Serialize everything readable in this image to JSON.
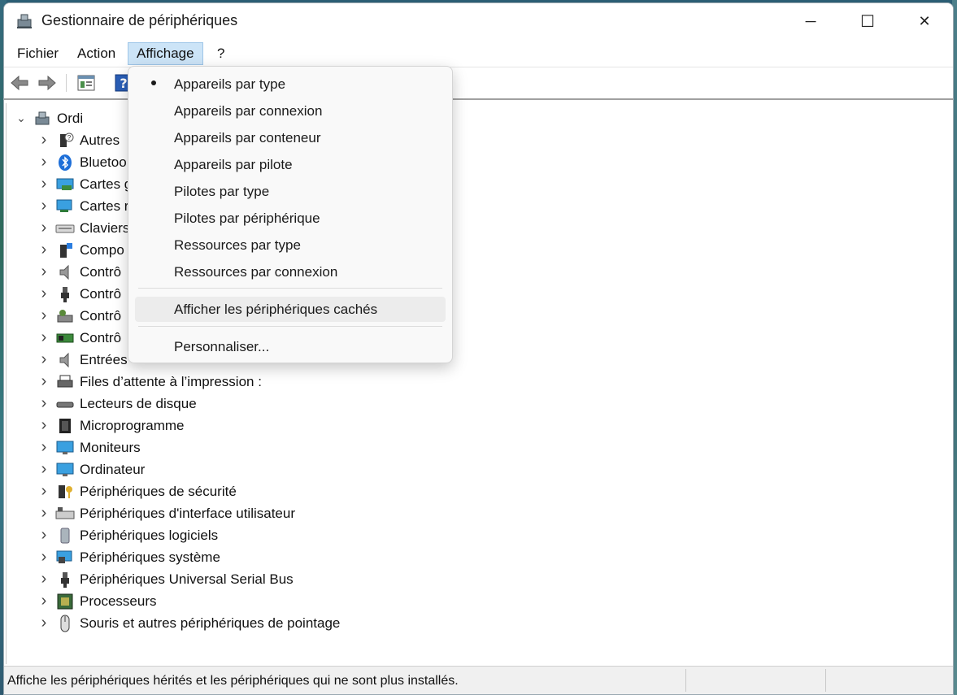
{
  "window": {
    "title": "Gestionnaire de périphériques",
    "controls": {
      "minimize": "─",
      "maximize": "☐",
      "close": "✕"
    }
  },
  "menubar": {
    "items": [
      {
        "label": "Fichier"
      },
      {
        "label": "Action"
      },
      {
        "label": "Affichage",
        "active": true
      },
      {
        "label": "?"
      }
    ]
  },
  "toolbar": {
    "buttons": [
      "back-arrow-icon",
      "forward-arrow-icon",
      "properties-icon",
      "help-icon"
    ]
  },
  "tree": {
    "root": {
      "label": "Ordi",
      "expanded": true
    },
    "categories": [
      {
        "label": "Autres",
        "icon": "unknown-device-icon"
      },
      {
        "label": "Bluetoo",
        "icon": "bluetooth-icon"
      },
      {
        "label": "Cartes g",
        "icon": "display-adapter-icon"
      },
      {
        "label": "Cartes r",
        "icon": "network-adapter-icon"
      },
      {
        "label": "Claviers",
        "icon": "keyboard-icon"
      },
      {
        "label": "Compo",
        "icon": "software-component-icon"
      },
      {
        "label": "Contrô",
        "icon": "audio-controller-icon"
      },
      {
        "label": "Contrô",
        "icon": "usb-controller-icon"
      },
      {
        "label": "Contrô",
        "icon": "storage-controller-icon"
      },
      {
        "label": "Contrô",
        "icon": "ide-controller-icon"
      },
      {
        "label": "Entrées",
        "icon": "audio-input-icon"
      },
      {
        "label": "Files d’attente à l’impression :",
        "icon": "printer-icon"
      },
      {
        "label": "Lecteurs de disque",
        "icon": "disk-drive-icon"
      },
      {
        "label": "Microprogramme",
        "icon": "firmware-icon"
      },
      {
        "label": "Moniteurs",
        "icon": "monitor-icon"
      },
      {
        "label": "Ordinateur",
        "icon": "computer-icon"
      },
      {
        "label": "Périphériques de sécurité",
        "icon": "security-device-icon"
      },
      {
        "label": "Périphériques d'interface utilisateur",
        "icon": "hid-icon"
      },
      {
        "label": "Périphériques logiciels",
        "icon": "software-device-icon"
      },
      {
        "label": "Périphériques système",
        "icon": "system-device-icon"
      },
      {
        "label": "Périphériques Universal Serial Bus",
        "icon": "usb-device-icon"
      },
      {
        "label": "Processeurs",
        "icon": "processor-icon"
      },
      {
        "label": "Souris et autres périphériques de pointage",
        "icon": "mouse-icon"
      }
    ]
  },
  "dropdown": {
    "items": [
      {
        "label": "Appareils par type",
        "checked": true
      },
      {
        "label": "Appareils par connexion"
      },
      {
        "label": "Appareils par conteneur"
      },
      {
        "label": "Appareils par pilote"
      },
      {
        "label": "Pilotes par type"
      },
      {
        "label": "Pilotes par périphérique"
      },
      {
        "label": "Ressources par type"
      },
      {
        "label": "Ressources par connexion"
      },
      {
        "label": "Afficher les périphériques cachés",
        "hover": true
      },
      {
        "label": "Personnaliser..."
      }
    ]
  },
  "status": {
    "text": "Affiche les périphériques hérités et les périphériques qui ne sont plus installés."
  },
  "colors": {
    "menu_active_bg": "#cce4f7",
    "accent_blue": "#1e7bd8"
  }
}
